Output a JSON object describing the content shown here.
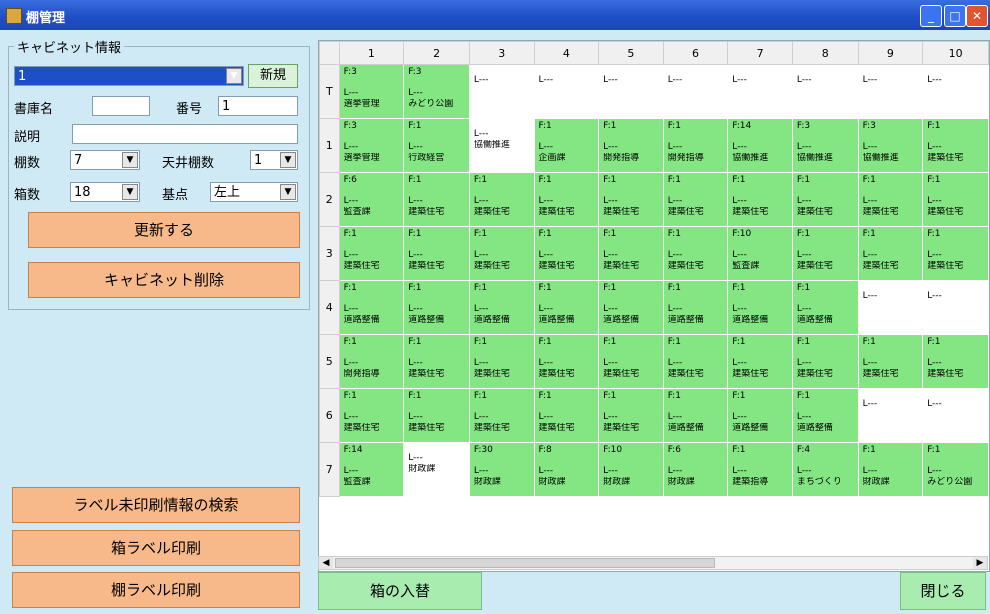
{
  "window": {
    "title": "棚管理"
  },
  "cabinet": {
    "group_label": "キャビネット情報",
    "selected": "1",
    "new_button": "新規",
    "library_label": "書庫名",
    "library_value": "",
    "number_label": "番号",
    "number_value": "1",
    "desc_label": "説明",
    "desc_value": "",
    "shelves_label": "棚数",
    "shelves_value": "7",
    "ceiling_label": "天井棚数",
    "ceiling_value": "1",
    "boxes_label": "箱数",
    "boxes_value": "18",
    "origin_label": "基点",
    "origin_value": "左上",
    "update_button": "更新する",
    "delete_button": "キャビネット削除"
  },
  "bottom_left": {
    "search_unprinted": "ラベル未印刷情報の検索",
    "box_label_print": "箱ラベル印刷",
    "shelf_label_print": "棚ラベル印刷"
  },
  "grid": {
    "columns": [
      "1",
      "2",
      "3",
      "4",
      "5",
      "6",
      "7",
      "8",
      "9",
      "10"
    ],
    "rows": [
      {
        "label": "T",
        "cells": [
          {
            "f": "F:3",
            "l": "L---",
            "n": "選挙管理",
            "g": true
          },
          {
            "f": "F:3",
            "l": "L---",
            "n": "みどり公園",
            "g": true
          },
          {
            "f": "",
            "l": "L---",
            "n": "",
            "g": false
          },
          {
            "f": "",
            "l": "L---",
            "n": "",
            "g": false
          },
          {
            "f": "",
            "l": "L---",
            "n": "",
            "g": false
          },
          {
            "f": "",
            "l": "L---",
            "n": "",
            "g": false
          },
          {
            "f": "",
            "l": "L---",
            "n": "",
            "g": false
          },
          {
            "f": "",
            "l": "L---",
            "n": "",
            "g": false
          },
          {
            "f": "",
            "l": "L---",
            "n": "",
            "g": false
          },
          {
            "f": "",
            "l": "L---",
            "n": "",
            "g": false
          }
        ]
      },
      {
        "label": "1",
        "cells": [
          {
            "f": "F:3",
            "l": "L---",
            "n": "選挙管理",
            "g": true
          },
          {
            "f": "F:1",
            "l": "L---",
            "n": "行政経営",
            "g": true
          },
          {
            "f": "",
            "l": "L---",
            "n": "協働推進",
            "g": false
          },
          {
            "f": "F:1",
            "l": "L---",
            "n": "企画課",
            "g": true
          },
          {
            "f": "F:1",
            "l": "L---",
            "n": "開発指導",
            "g": true
          },
          {
            "f": "F:1",
            "l": "L---",
            "n": "開発指導",
            "g": true
          },
          {
            "f": "F:14",
            "l": "L---",
            "n": "協働推進",
            "g": true
          },
          {
            "f": "F:3",
            "l": "L---",
            "n": "協働推進",
            "g": true
          },
          {
            "f": "F:3",
            "l": "L---",
            "n": "協働推進",
            "g": true
          },
          {
            "f": "F:1",
            "l": "L---",
            "n": "建築住宅",
            "g": true
          }
        ]
      },
      {
        "label": "2",
        "cells": [
          {
            "f": "F:6",
            "l": "L---",
            "n": "監査課",
            "g": true
          },
          {
            "f": "F:1",
            "l": "L---",
            "n": "建築住宅",
            "g": true
          },
          {
            "f": "F:1",
            "l": "L---",
            "n": "建築住宅",
            "g": true
          },
          {
            "f": "F:1",
            "l": "L---",
            "n": "建築住宅",
            "g": true
          },
          {
            "f": "F:1",
            "l": "L---",
            "n": "建築住宅",
            "g": true
          },
          {
            "f": "F:1",
            "l": "L---",
            "n": "建築住宅",
            "g": true
          },
          {
            "f": "F:1",
            "l": "L---",
            "n": "建築住宅",
            "g": true
          },
          {
            "f": "F:1",
            "l": "L---",
            "n": "建築住宅",
            "g": true
          },
          {
            "f": "F:1",
            "l": "L---",
            "n": "建築住宅",
            "g": true
          },
          {
            "f": "F:1",
            "l": "L---",
            "n": "建築住宅",
            "g": true
          }
        ]
      },
      {
        "label": "3",
        "cells": [
          {
            "f": "F:1",
            "l": "L---",
            "n": "建築住宅",
            "g": true
          },
          {
            "f": "F:1",
            "l": "L---",
            "n": "建築住宅",
            "g": true
          },
          {
            "f": "F:1",
            "l": "L---",
            "n": "建築住宅",
            "g": true
          },
          {
            "f": "F:1",
            "l": "L---",
            "n": "建築住宅",
            "g": true
          },
          {
            "f": "F:1",
            "l": "L---",
            "n": "建築住宅",
            "g": true
          },
          {
            "f": "F:1",
            "l": "L---",
            "n": "建築住宅",
            "g": true
          },
          {
            "f": "F:10",
            "l": "L---",
            "n": "監査課",
            "g": true
          },
          {
            "f": "F:1",
            "l": "L---",
            "n": "建築住宅",
            "g": true
          },
          {
            "f": "F:1",
            "l": "L---",
            "n": "建築住宅",
            "g": true
          },
          {
            "f": "F:1",
            "l": "L---",
            "n": "建築住宅",
            "g": true
          }
        ]
      },
      {
        "label": "4",
        "cells": [
          {
            "f": "F:1",
            "l": "L---",
            "n": "道路整備",
            "g": true
          },
          {
            "f": "F:1",
            "l": "L---",
            "n": "道路整備",
            "g": true
          },
          {
            "f": "F:1",
            "l": "L---",
            "n": "道路整備",
            "g": true
          },
          {
            "f": "F:1",
            "l": "L---",
            "n": "道路整備",
            "g": true
          },
          {
            "f": "F:1",
            "l": "L---",
            "n": "道路整備",
            "g": true
          },
          {
            "f": "F:1",
            "l": "L---",
            "n": "道路整備",
            "g": true
          },
          {
            "f": "F:1",
            "l": "L---",
            "n": "道路整備",
            "g": true
          },
          {
            "f": "F:1",
            "l": "L---",
            "n": "道路整備",
            "g": true
          },
          {
            "f": "",
            "l": "L---",
            "n": "",
            "g": false
          },
          {
            "f": "",
            "l": "L---",
            "n": "",
            "g": false
          }
        ]
      },
      {
        "label": "5",
        "cells": [
          {
            "f": "F:1",
            "l": "L---",
            "n": "開発指導",
            "g": true
          },
          {
            "f": "F:1",
            "l": "L---",
            "n": "建築住宅",
            "g": true
          },
          {
            "f": "F:1",
            "l": "L---",
            "n": "建築住宅",
            "g": true
          },
          {
            "f": "F:1",
            "l": "L---",
            "n": "建築住宅",
            "g": true
          },
          {
            "f": "F:1",
            "l": "L---",
            "n": "建築住宅",
            "g": true
          },
          {
            "f": "F:1",
            "l": "L---",
            "n": "建築住宅",
            "g": true
          },
          {
            "f": "F:1",
            "l": "L---",
            "n": "建築住宅",
            "g": true
          },
          {
            "f": "F:1",
            "l": "L---",
            "n": "建築住宅",
            "g": true
          },
          {
            "f": "F:1",
            "l": "L---",
            "n": "建築住宅",
            "g": true
          },
          {
            "f": "F:1",
            "l": "L---",
            "n": "建築住宅",
            "g": true
          }
        ]
      },
      {
        "label": "6",
        "cells": [
          {
            "f": "F:1",
            "l": "L---",
            "n": "建築住宅",
            "g": true
          },
          {
            "f": "F:1",
            "l": "L---",
            "n": "建築住宅",
            "g": true
          },
          {
            "f": "F:1",
            "l": "L---",
            "n": "建築住宅",
            "g": true
          },
          {
            "f": "F:1",
            "l": "L---",
            "n": "建築住宅",
            "g": true
          },
          {
            "f": "F:1",
            "l": "L---",
            "n": "建築住宅",
            "g": true
          },
          {
            "f": "F:1",
            "l": "L---",
            "n": "道路整備",
            "g": true
          },
          {
            "f": "F:1",
            "l": "L---",
            "n": "道路整備",
            "g": true
          },
          {
            "f": "F:1",
            "l": "L---",
            "n": "道路整備",
            "g": true
          },
          {
            "f": "",
            "l": "L---",
            "n": "",
            "g": false
          },
          {
            "f": "",
            "l": "L---",
            "n": "",
            "g": false
          }
        ]
      },
      {
        "label": "7",
        "cells": [
          {
            "f": "F:14",
            "l": "L---",
            "n": "監査課",
            "g": true
          },
          {
            "f": "",
            "l": "L---",
            "n": "財政課",
            "g": false
          },
          {
            "f": "F:30",
            "l": "L---",
            "n": "財政課",
            "g": true
          },
          {
            "f": "F:8",
            "l": "L---",
            "n": "財政課",
            "g": true
          },
          {
            "f": "F:10",
            "l": "L---",
            "n": "財政課",
            "g": true
          },
          {
            "f": "F:6",
            "l": "L---",
            "n": "財政課",
            "g": true
          },
          {
            "f": "F:1",
            "l": "L---",
            "n": "建築指導",
            "g": true
          },
          {
            "f": "F:4",
            "l": "L---",
            "n": "まちづくり",
            "g": true
          },
          {
            "f": "F:1",
            "l": "L---",
            "n": "財政課",
            "g": true
          },
          {
            "f": "F:1",
            "l": "L---",
            "n": "みどり公園",
            "g": true
          }
        ]
      }
    ]
  },
  "footer": {
    "swap_button": "箱の入替",
    "close_button": "閉じる"
  }
}
